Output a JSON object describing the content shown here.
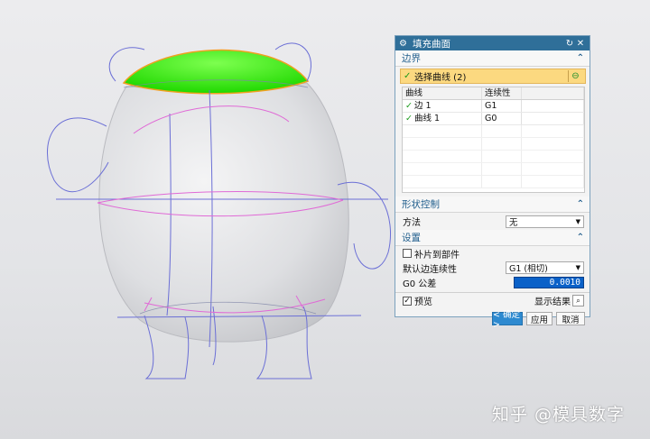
{
  "dialog": {
    "title": "填充曲面",
    "sections": {
      "boundary": "边界",
      "shape": "形状控制",
      "settings": "设置"
    },
    "select_curve": "选择曲线 (2)",
    "list": {
      "headers": [
        "曲线",
        "连续性"
      ],
      "rows": [
        {
          "name": "边 1",
          "continuity": "G1"
        },
        {
          "name": "曲线 1",
          "continuity": "G0"
        }
      ]
    },
    "method_label": "方法",
    "method_value": "无",
    "patch_label": "补片到部件",
    "default_cont_label": "默认边连续性",
    "default_cont_value": "G1 (相切)",
    "g0_label": "G0 公差",
    "g0_value": "0.0010",
    "preview_label": "预览",
    "show_result": "显示结果",
    "ok": "< 确定 >",
    "apply": "应用",
    "cancel": "取消"
  },
  "watermark": "知乎 @模具数字",
  "colors": {
    "title_bar": "#2f6f99",
    "fill_surface": "#22e000",
    "section_text": "#1f5d8c",
    "selected_row": "#fcd980"
  }
}
